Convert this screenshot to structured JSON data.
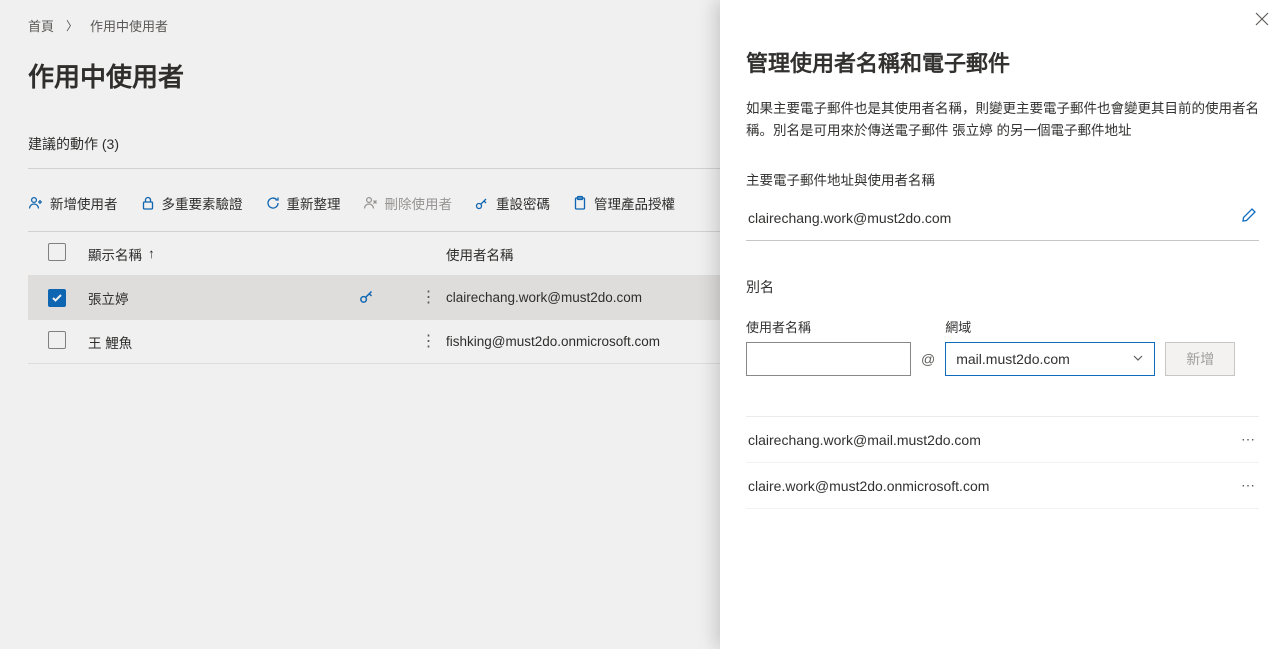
{
  "breadcrumb": {
    "home": "首頁",
    "current": "作用中使用者"
  },
  "page": {
    "title": "作用中使用者"
  },
  "suggested": {
    "label": "建議的動作 (3)"
  },
  "toolbar": {
    "add_user": "新增使用者",
    "mfa": "多重要素驗證",
    "refresh": "重新整理",
    "delete_user": "刪除使用者",
    "reset_pw": "重設密碼",
    "manage_license": "管理產品授權"
  },
  "table": {
    "col_display": "顯示名稱",
    "col_username": "使用者名稱",
    "rows": [
      {
        "selected": true,
        "display": "張立婷",
        "key": true,
        "username": "clairechang.work@must2do.com"
      },
      {
        "selected": false,
        "display": "王 鯉魚",
        "key": false,
        "username": "fishking@must2do.onmicrosoft.com"
      }
    ]
  },
  "panel": {
    "title": "管理使用者名稱和電子郵件",
    "description": "如果主要電子郵件也是其使用者名稱，則變更主要電子郵件也會變更其目前的使用者名稱。別名是可用來於傳送電子郵件 張立婷 的另一個電子郵件地址",
    "primary_section": "主要電子郵件地址與使用者名稱",
    "primary_value": "clairechang.work@must2do.com",
    "alias_section": "別名",
    "username_label": "使用者名稱",
    "domain_label": "網域",
    "domain_value": "mail.must2do.com",
    "add_button": "新增",
    "aliases": [
      "clairechang.work@mail.must2do.com",
      "claire.work@must2do.onmicrosoft.com"
    ]
  }
}
